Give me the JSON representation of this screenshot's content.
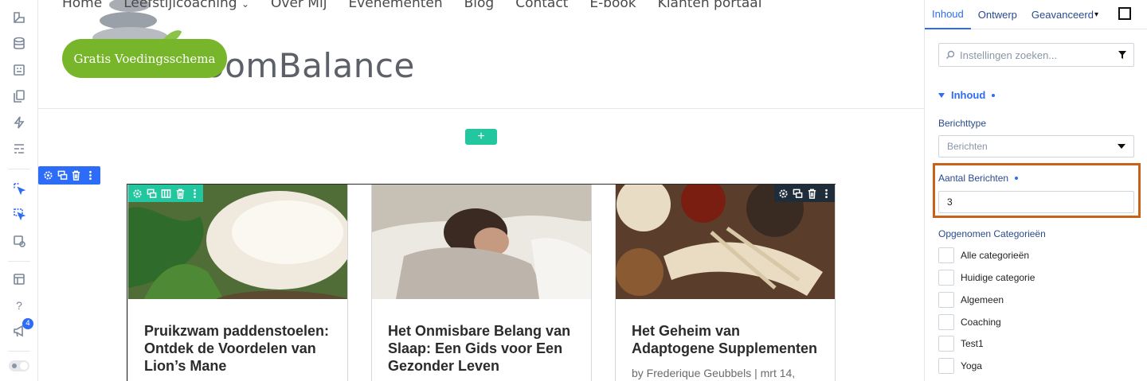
{
  "canvas": {
    "nav": [
      "Home",
      "Leefstijlcoaching",
      "Over Mij",
      "Evenementen",
      "Blog",
      "Contact",
      "E-book",
      "Klanten portaal"
    ],
    "nav_dropdown_marker": "⌄",
    "logo_text": "oomBalance",
    "cta_label": "Gratis Voedingsschema",
    "add_section_label": "+",
    "posts": [
      {
        "title": "Pruikzwam paddenstoelen: Ontdek de Voordelen van Lion’s Mane",
        "meta": ""
      },
      {
        "title": "Het Onmisbare Belang van Slaap: Een Gids voor Een Gezonder Leven",
        "meta": ""
      },
      {
        "title": "Het Geheim van Adaptogene Supplementen",
        "meta": "by Frederique Geubbels | mrt 14,"
      }
    ]
  },
  "rail": {
    "badge_count": "4",
    "help_glyph": "?"
  },
  "panel": {
    "tabs": [
      "Inhoud",
      "Ontwerp",
      "Geavanceerd"
    ],
    "tab_dropdown_marker": "▾",
    "search_placeholder": "Instellingen zoeken...",
    "section_title": "Inhoud",
    "post_type_label": "Berichttype",
    "post_type_value": "Berichten",
    "post_count_label": "Aantal Berichten",
    "post_count_value": "3",
    "categories_label": "Opgenomen Categorieën",
    "categories": [
      "Alle categorieën",
      "Huidige categorie",
      "Algemeen",
      "Coaching",
      "Test1",
      "Yoga"
    ]
  },
  "colors": {
    "accent": "#2d6cf6",
    "cta_green": "#77b52b",
    "add_teal": "#22c7a0",
    "highlight_orange": "#c8621a"
  }
}
